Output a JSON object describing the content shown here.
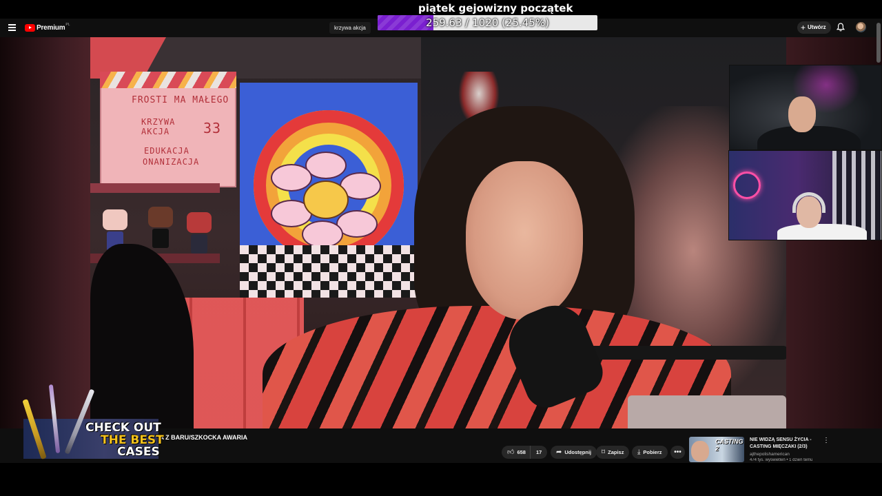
{
  "overlay": {
    "goal_title": "piątek gejowizny początek",
    "goal_progress_text": "259.63 / 1020 (25.45%)",
    "goal_fraction": 0.2545
  },
  "topbar": {
    "menu_icon": "hamburger-menu-icon",
    "logo_text": "Premium",
    "logo_region": "PL",
    "search_chip": "krzywa akcja",
    "create_label": "Utwórz",
    "create_icon": "plus-icon",
    "notifications_icon": "bell-icon"
  },
  "video": {
    "clapperboard": {
      "prod": "FROSTI MA MAŁEGO",
      "scene": "KRZYWA AKCJA",
      "take": "33",
      "director": "EDUKACJA",
      "camera": "ONANIZACJA"
    }
  },
  "ad": {
    "line1": "CHECK OUT",
    "line2": "THE BEST",
    "line3": "CASES"
  },
  "bottombar": {
    "video_title": "IA Z BARU/SZKOCKA AWARIA",
    "likes": "658",
    "dislikes": "17",
    "share_label": "Udostępnij",
    "save_label": "Zapisz",
    "download_label": "Pobierz",
    "more_icon": "more-horizontal-icon"
  },
  "recommendation": {
    "thumbnail_label": "CASTING 2",
    "title": "NIE WIDZĄ SENSU ŻYCIA - CASTING MIĘCZAKI (2/3)",
    "channel": "ajthepolishamerican",
    "meta": "474 tys. wyświetleń • 1 dzień temu"
  },
  "colors": {
    "goal_fill": "#7a1fd0",
    "youtube_red": "#ff0000",
    "ad_accent": "#f6c21c"
  }
}
